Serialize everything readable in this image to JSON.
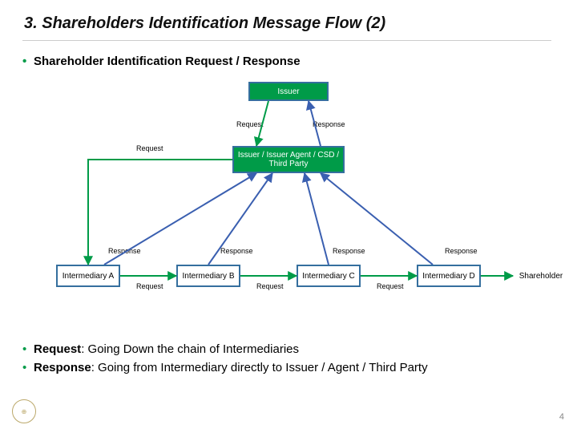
{
  "slide": {
    "title": "3. Shareholders Identification Message Flow (2)",
    "subtitle": "Shareholder Identification Request / Response",
    "bullet1_bold": "Request",
    "bullet1_rest": ": Going Down the chain of Intermediaries",
    "bullet2_bold": "Response",
    "bullet2_rest": ": Going from Intermediary directly to Issuer / Agent / Third Party",
    "page_number": "4"
  },
  "diagram": {
    "issuer_label": "Issuer",
    "agent_label": "Issuer / Issuer Agent / CSD / Third Party",
    "intermediaries": [
      "Intermediary A",
      "Intermediary B",
      "Intermediary C",
      "Intermediary D"
    ],
    "shareholder_label": "Shareholder",
    "request_label": "Request",
    "response_label": "Response"
  },
  "footer": {
    "logo_text": "⊕"
  }
}
